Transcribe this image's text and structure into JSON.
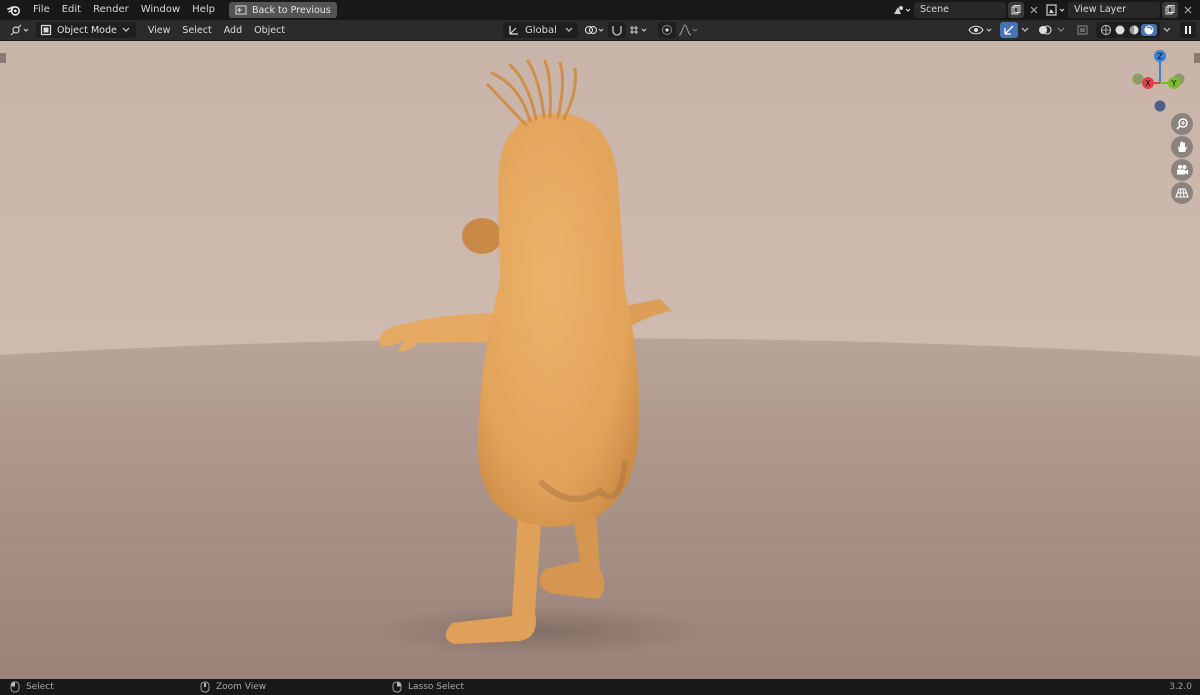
{
  "topbar": {
    "menus": [
      "File",
      "Edit",
      "Render",
      "Window",
      "Help"
    ],
    "back_button": "Back to Previous",
    "scene_field": "Scene",
    "view_layer_field": "View Layer"
  },
  "viewport_header": {
    "mode": "Object Mode",
    "menus": [
      "View",
      "Select",
      "Add",
      "Object"
    ],
    "transform_orientation": "Global"
  },
  "gizmo": {
    "x_label": "X",
    "y_label": "Y",
    "z_label": "Z",
    "x_color": "#e0404d",
    "y_color": "#7bbd2c",
    "z_color": "#3b82d6"
  },
  "statusbar": {
    "select": "Select",
    "zoom_view": "Zoom View",
    "lasso_select": "Lasso Select",
    "version": "3.2.0"
  },
  "colors": {
    "accent": "#4772b3",
    "character": "#e3a65c",
    "background": "#cbb7ab"
  }
}
